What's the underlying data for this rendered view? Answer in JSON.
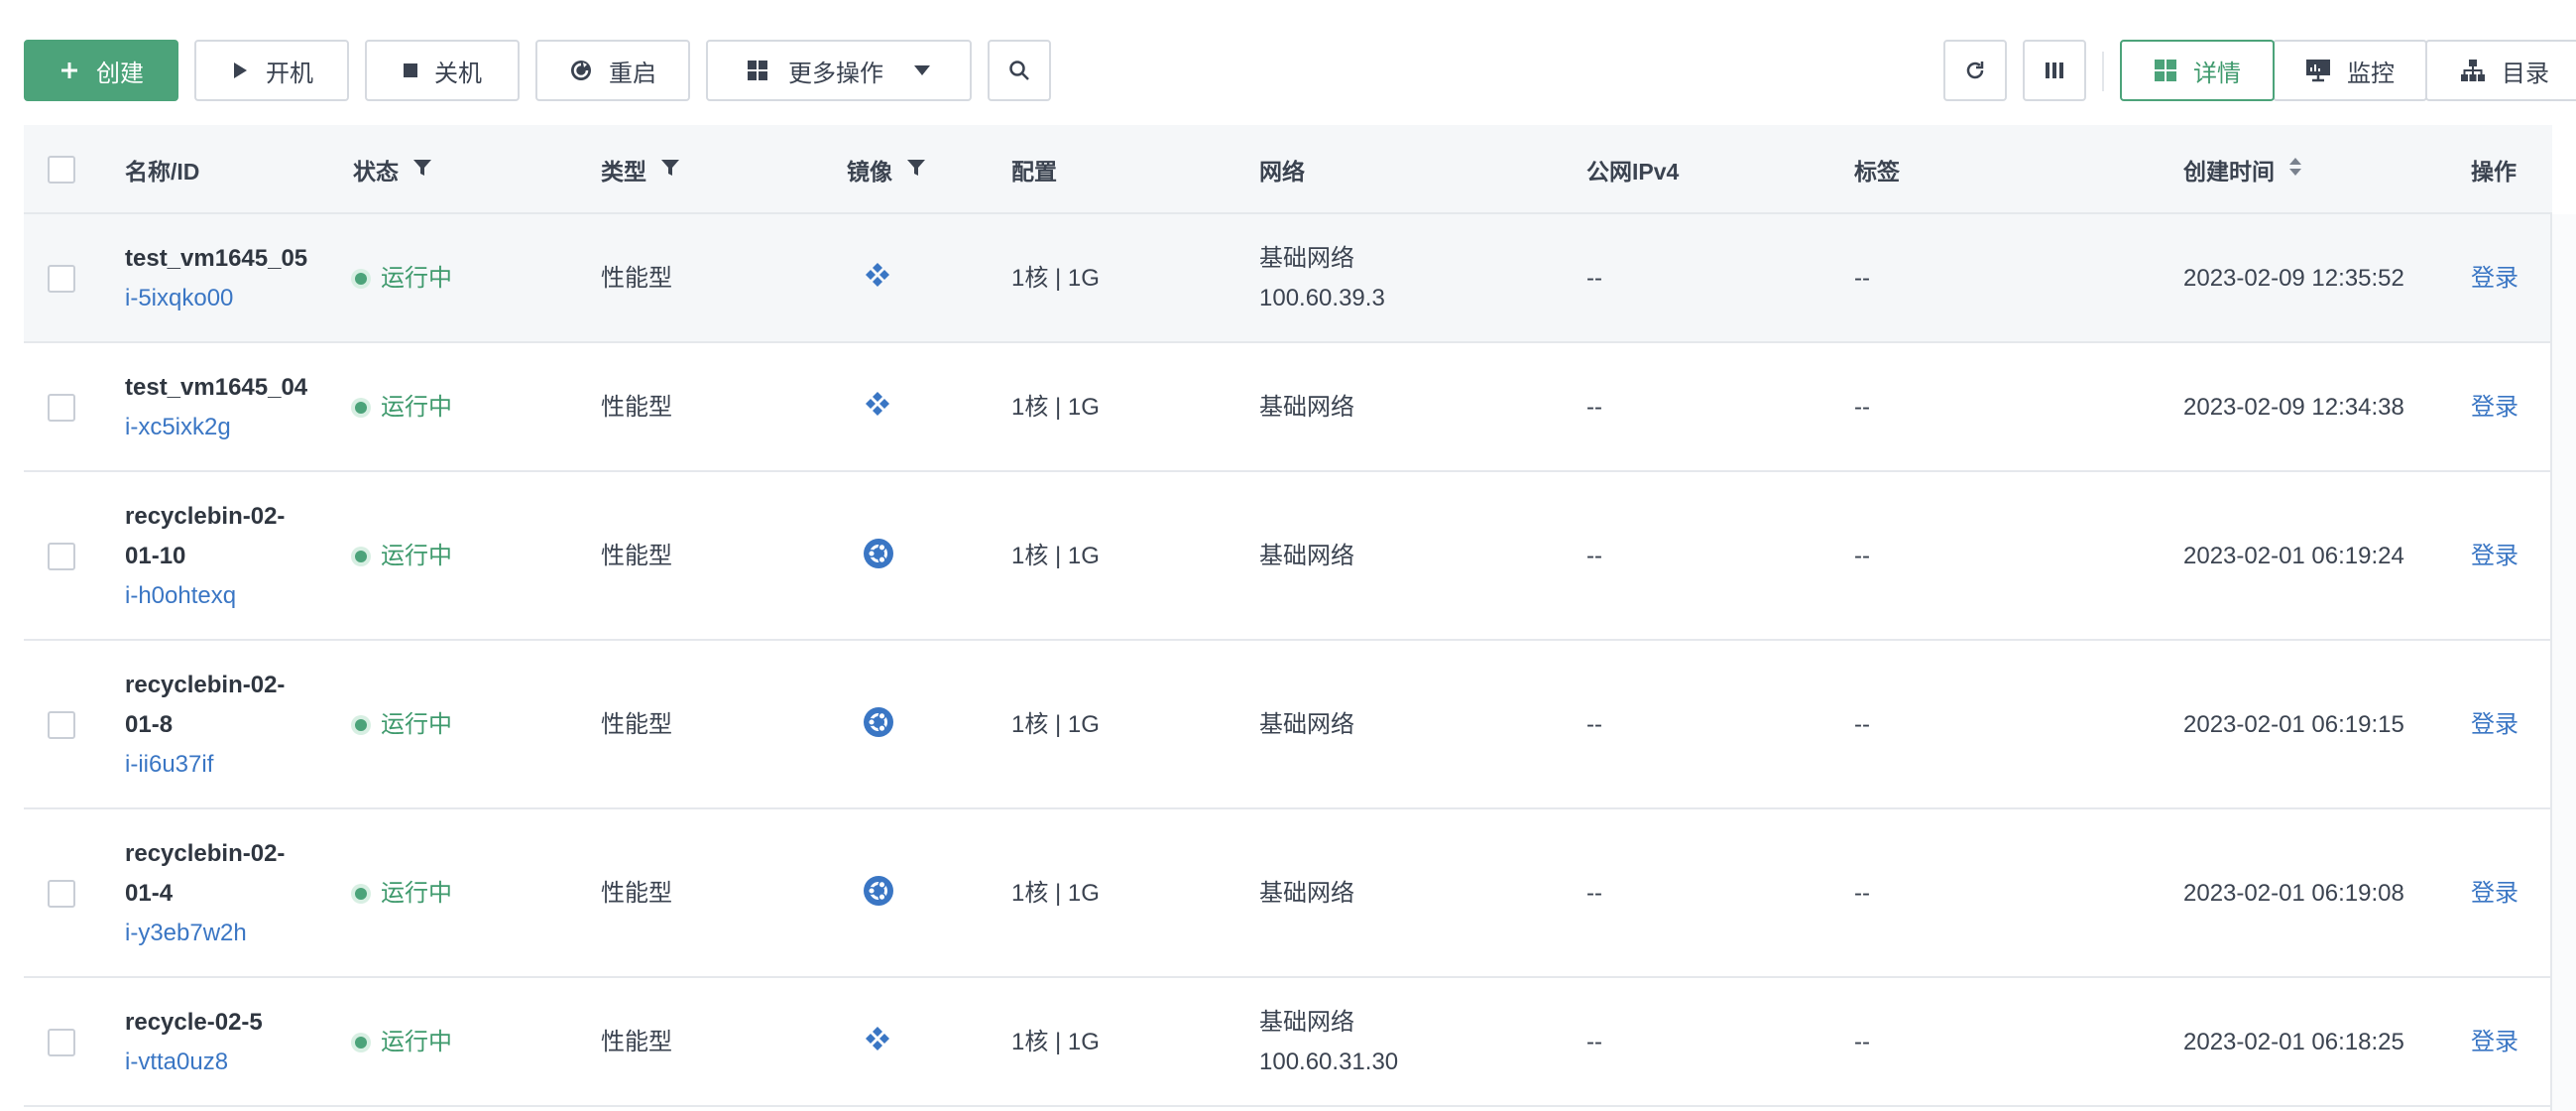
{
  "toolbar": {
    "create": "创建",
    "start": "开机",
    "stop": "关机",
    "restart": "重启",
    "more": "更多操作"
  },
  "views": {
    "detail": "详情",
    "monitor": "监控",
    "catalog": "目录"
  },
  "columns": {
    "name": "名称/ID",
    "status": "状态",
    "type": "类型",
    "image": "镜像",
    "config": "配置",
    "network": "网络",
    "ipv4": "公网IPv4",
    "tags": "标签",
    "created": "创建时间",
    "actions": "操作"
  },
  "rows": [
    {
      "name1": "test_vm1645_05",
      "name2": "",
      "id": "i-5ixqko00",
      "status": "运行中",
      "type": "性能型",
      "image_icon": "diamond-image-icon",
      "config": "1核 | 1G",
      "network": "基础网络",
      "ip": "100.60.39.3",
      "ipv4": "--",
      "tags": "--",
      "created": "2023-02-09 12:35:52",
      "action": "登录"
    },
    {
      "name1": "test_vm1645_04",
      "name2": "",
      "id": "i-xc5ixk2g",
      "status": "运行中",
      "type": "性能型",
      "image_icon": "diamond-image-icon",
      "config": "1核 | 1G",
      "network": "基础网络",
      "ip": "",
      "ipv4": "--",
      "tags": "--",
      "created": "2023-02-09 12:34:38",
      "action": "登录"
    },
    {
      "name1": "recyclebin-02-",
      "name2": "01-10",
      "id": "i-h0ohtexq",
      "status": "运行中",
      "type": "性能型",
      "image_icon": "ubuntu-image-icon",
      "config": "1核 | 1G",
      "network": "基础网络",
      "ip": "",
      "ipv4": "--",
      "tags": "--",
      "created": "2023-02-01 06:19:24",
      "action": "登录"
    },
    {
      "name1": "recyclebin-02-",
      "name2": "01-8",
      "id": "i-ii6u37if",
      "status": "运行中",
      "type": "性能型",
      "image_icon": "ubuntu-image-icon",
      "config": "1核 | 1G",
      "network": "基础网络",
      "ip": "",
      "ipv4": "--",
      "tags": "--",
      "created": "2023-02-01 06:19:15",
      "action": "登录"
    },
    {
      "name1": "recyclebin-02-",
      "name2": "01-4",
      "id": "i-y3eb7w2h",
      "status": "运行中",
      "type": "性能型",
      "image_icon": "ubuntu-image-icon",
      "config": "1核 | 1G",
      "network": "基础网络",
      "ip": "",
      "ipv4": "--",
      "tags": "--",
      "created": "2023-02-01 06:19:08",
      "action": "登录"
    },
    {
      "name1": "recycle-02-5",
      "name2": "",
      "id": "i-vtta0uz8",
      "status": "运行中",
      "type": "性能型",
      "image_icon": "diamond-image-icon",
      "config": "1核 | 1G",
      "network": "基础网络",
      "ip": "100.60.31.30",
      "ipv4": "--",
      "tags": "--",
      "created": "2023-02-01 06:18:25",
      "action": "登录"
    }
  ]
}
